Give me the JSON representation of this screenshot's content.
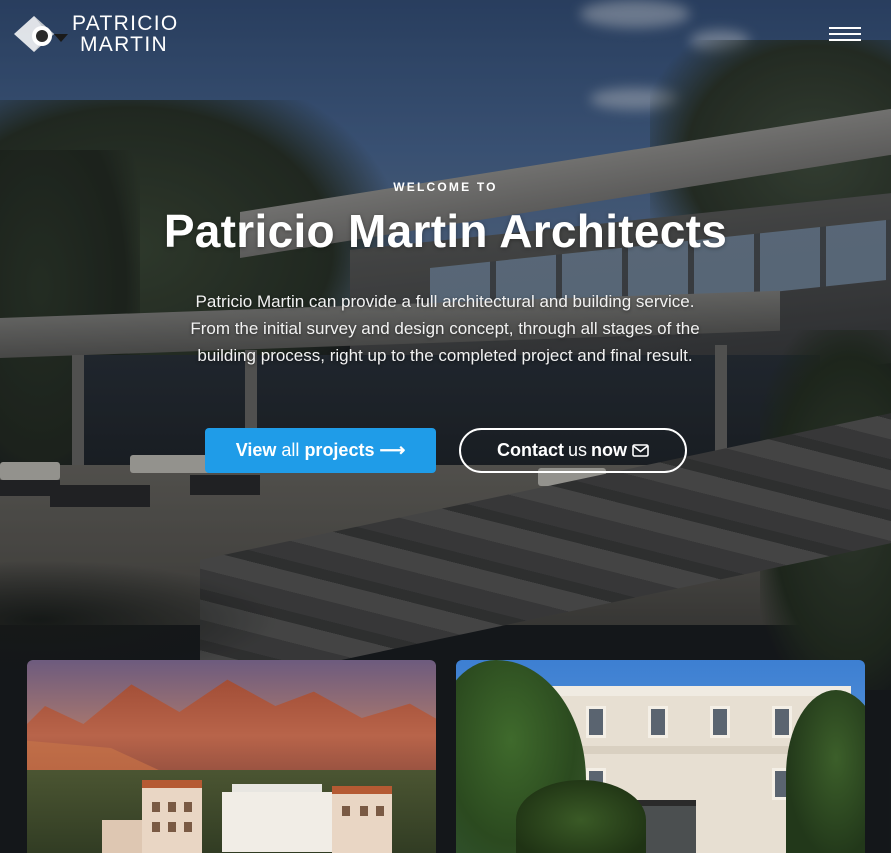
{
  "header": {
    "logo_line1": "PATRICIO",
    "logo_line2": "MARTIN",
    "menu_icon": "hamburger-menu-icon"
  },
  "hero": {
    "eyebrow": "WELCOME TO",
    "title": "Patricio Martin Architects",
    "lead": "Patricio Martin can provide a full architectural and building service. From the initial survey and design concept, through all stages of the building process, right up to the completed project and final result.",
    "primary_button": {
      "part1": "View",
      "part2": "all",
      "part3": "projects",
      "icon": "arrow-right-icon"
    },
    "secondary_button": {
      "part1": "Contact",
      "part2": "us",
      "part3": "now",
      "icon": "envelope-icon"
    }
  },
  "projects": [
    {
      "image": "mountain-resort-photo"
    },
    {
      "image": "classic-villa-photo"
    }
  ],
  "colors": {
    "primary_button_bg": "#1f9ce8",
    "text": "#ffffff"
  }
}
